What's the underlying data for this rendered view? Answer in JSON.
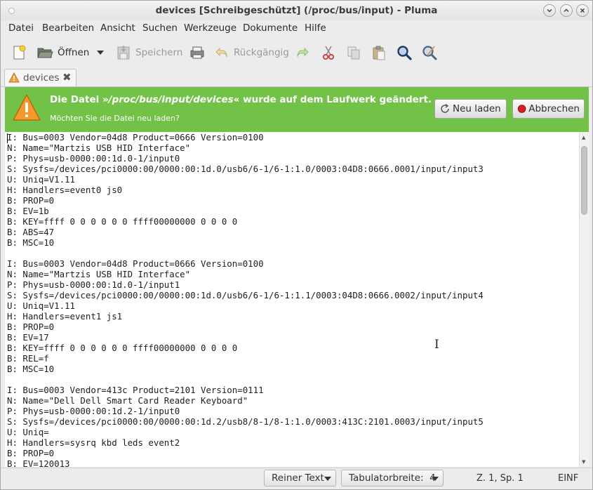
{
  "window": {
    "title": "devices [Schreibgeschützt] (/proc/bus/input) - Pluma",
    "controls": [
      "minimize",
      "maximize",
      "close"
    ]
  },
  "menubar": {
    "items": [
      "Datei",
      "Bearbeiten",
      "Ansicht",
      "Suchen",
      "Werkzeuge",
      "Dokumente",
      "Hilfe"
    ]
  },
  "toolbar": {
    "open_label": "Öffnen",
    "save_label": "Speichern",
    "undo_label": "Rückgängig"
  },
  "tab": {
    "label": "devices",
    "icon": "warning-icon"
  },
  "infobar": {
    "primary_prefix": "Die Datei »",
    "primary_path": "/proc/bus/input/devices",
    "primary_suffix": "« wurde auf dem Laufwerk geändert.",
    "secondary": "Möchten Sie die Datei neu laden?",
    "reload_label": "Neu laden",
    "cancel_label": "Abbrechen",
    "color": "#72c247"
  },
  "editor": {
    "content": "I: Bus=0003 Vendor=04d8 Product=0666 Version=0100\nN: Name=\"Martzis USB HID Interface\"\nP: Phys=usb-0000:00:1d.0-1/input0\nS: Sysfs=/devices/pci0000:00/0000:00:1d.0/usb6/6-1/6-1:1.0/0003:04D8:0666.0001/input/input3\nU: Uniq=V1.11\nH: Handlers=event0 js0\nB: PROP=0\nB: EV=1b\nB: KEY=ffff 0 0 0 0 0 0 ffff00000000 0 0 0 0\nB: ABS=47\nB: MSC=10\n\nI: Bus=0003 Vendor=04d8 Product=0666 Version=0100\nN: Name=\"Martzis USB HID Interface\"\nP: Phys=usb-0000:00:1d.0-1/input1\nS: Sysfs=/devices/pci0000:00/0000:00:1d.0/usb6/6-1/6-1:1.1/0003:04D8:0666.0002/input/input4\nU: Uniq=V1.11\nH: Handlers=event1 js1\nB: PROP=0\nB: EV=17\nB: KEY=ffff 0 0 0 0 0 0 ffff00000000 0 0 0 0\nB: REL=f\nB: MSC=10\n\nI: Bus=0003 Vendor=413c Product=2101 Version=0111\nN: Name=\"Dell Dell Smart Card Reader Keyboard\"\nP: Phys=usb-0000:00:1d.2-1/input0\nS: Sysfs=/devices/pci0000:00/0000:00:1d.2/usb8/8-1/8-1:1.0/0003:413C:2101.0003/input/input5\nU: Uniq=\nH: Handlers=sysrq kbd leds event2\nB: PROP=0\nB: EV=120013"
  },
  "statusbar": {
    "language": "Reiner Text",
    "tab_width": "Tabulatorbreite:  4",
    "position": "Z. 1, Sp. 1",
    "mode": "EINF"
  }
}
